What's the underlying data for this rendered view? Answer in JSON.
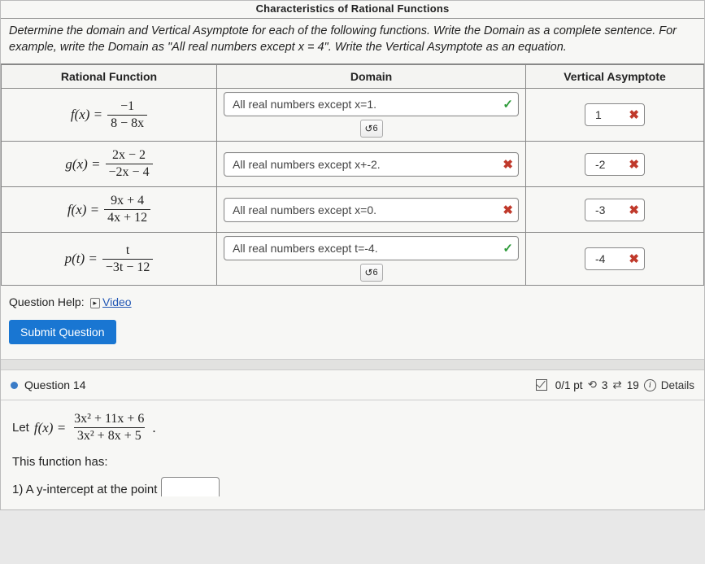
{
  "header_partial": "Characteristics of Rational Functions",
  "instructions": "Determine the domain and Vertical Asymptote for each of the following functions. Write the Domain as a complete sentence. For example, write the Domain as \"All real numbers except x = 4\". Write the Vertical Asymptote as an equation.",
  "table": {
    "headers": {
      "func": "Rational Function",
      "domain": "Domain",
      "va": "Vertical Asymptote"
    },
    "rows": [
      {
        "lhs": "f(x) =",
        "num": "−1",
        "den": "8 − 8x",
        "domain_value": "All real numbers except x=1.",
        "domain_status": "correct",
        "show_retry": true,
        "va_value": "1",
        "va_status": "wrong"
      },
      {
        "lhs": "g(x) =",
        "num": "2x − 2",
        "den": "−2x − 4",
        "domain_value": "All real numbers except x+-2.",
        "domain_status": "wrong",
        "show_retry": false,
        "va_value": "-2",
        "va_status": "wrong"
      },
      {
        "lhs": "f(x) =",
        "num": "9x + 4",
        "den": "4x + 12",
        "domain_value": "All real numbers except x=0.",
        "domain_status": "wrong",
        "show_retry": false,
        "va_value": "-3",
        "va_status": "wrong"
      },
      {
        "lhs": "p(t) =",
        "num": "t",
        "den": "−3t − 12",
        "domain_value": "All real numbers except t=-4.",
        "domain_status": "correct",
        "show_retry": true,
        "va_value": "-4",
        "va_status": "wrong"
      }
    ]
  },
  "help": {
    "label": "Question Help:",
    "video": "Video"
  },
  "submit_label": "Submit Question",
  "q14": {
    "title": "Question 14",
    "score": "0/1 pt",
    "retries": "3",
    "attempts": "19",
    "details": "Details",
    "let": "Let",
    "lhs": "f(x) =",
    "num": "3x² + 11x + 6",
    "den": "3x² + 8x + 5",
    "period": ".",
    "has_line": "This function has:",
    "item1": "1) A y-intercept at the point"
  },
  "glyphs": {
    "check": "✓",
    "cross": "✖",
    "retry": "↺"
  }
}
